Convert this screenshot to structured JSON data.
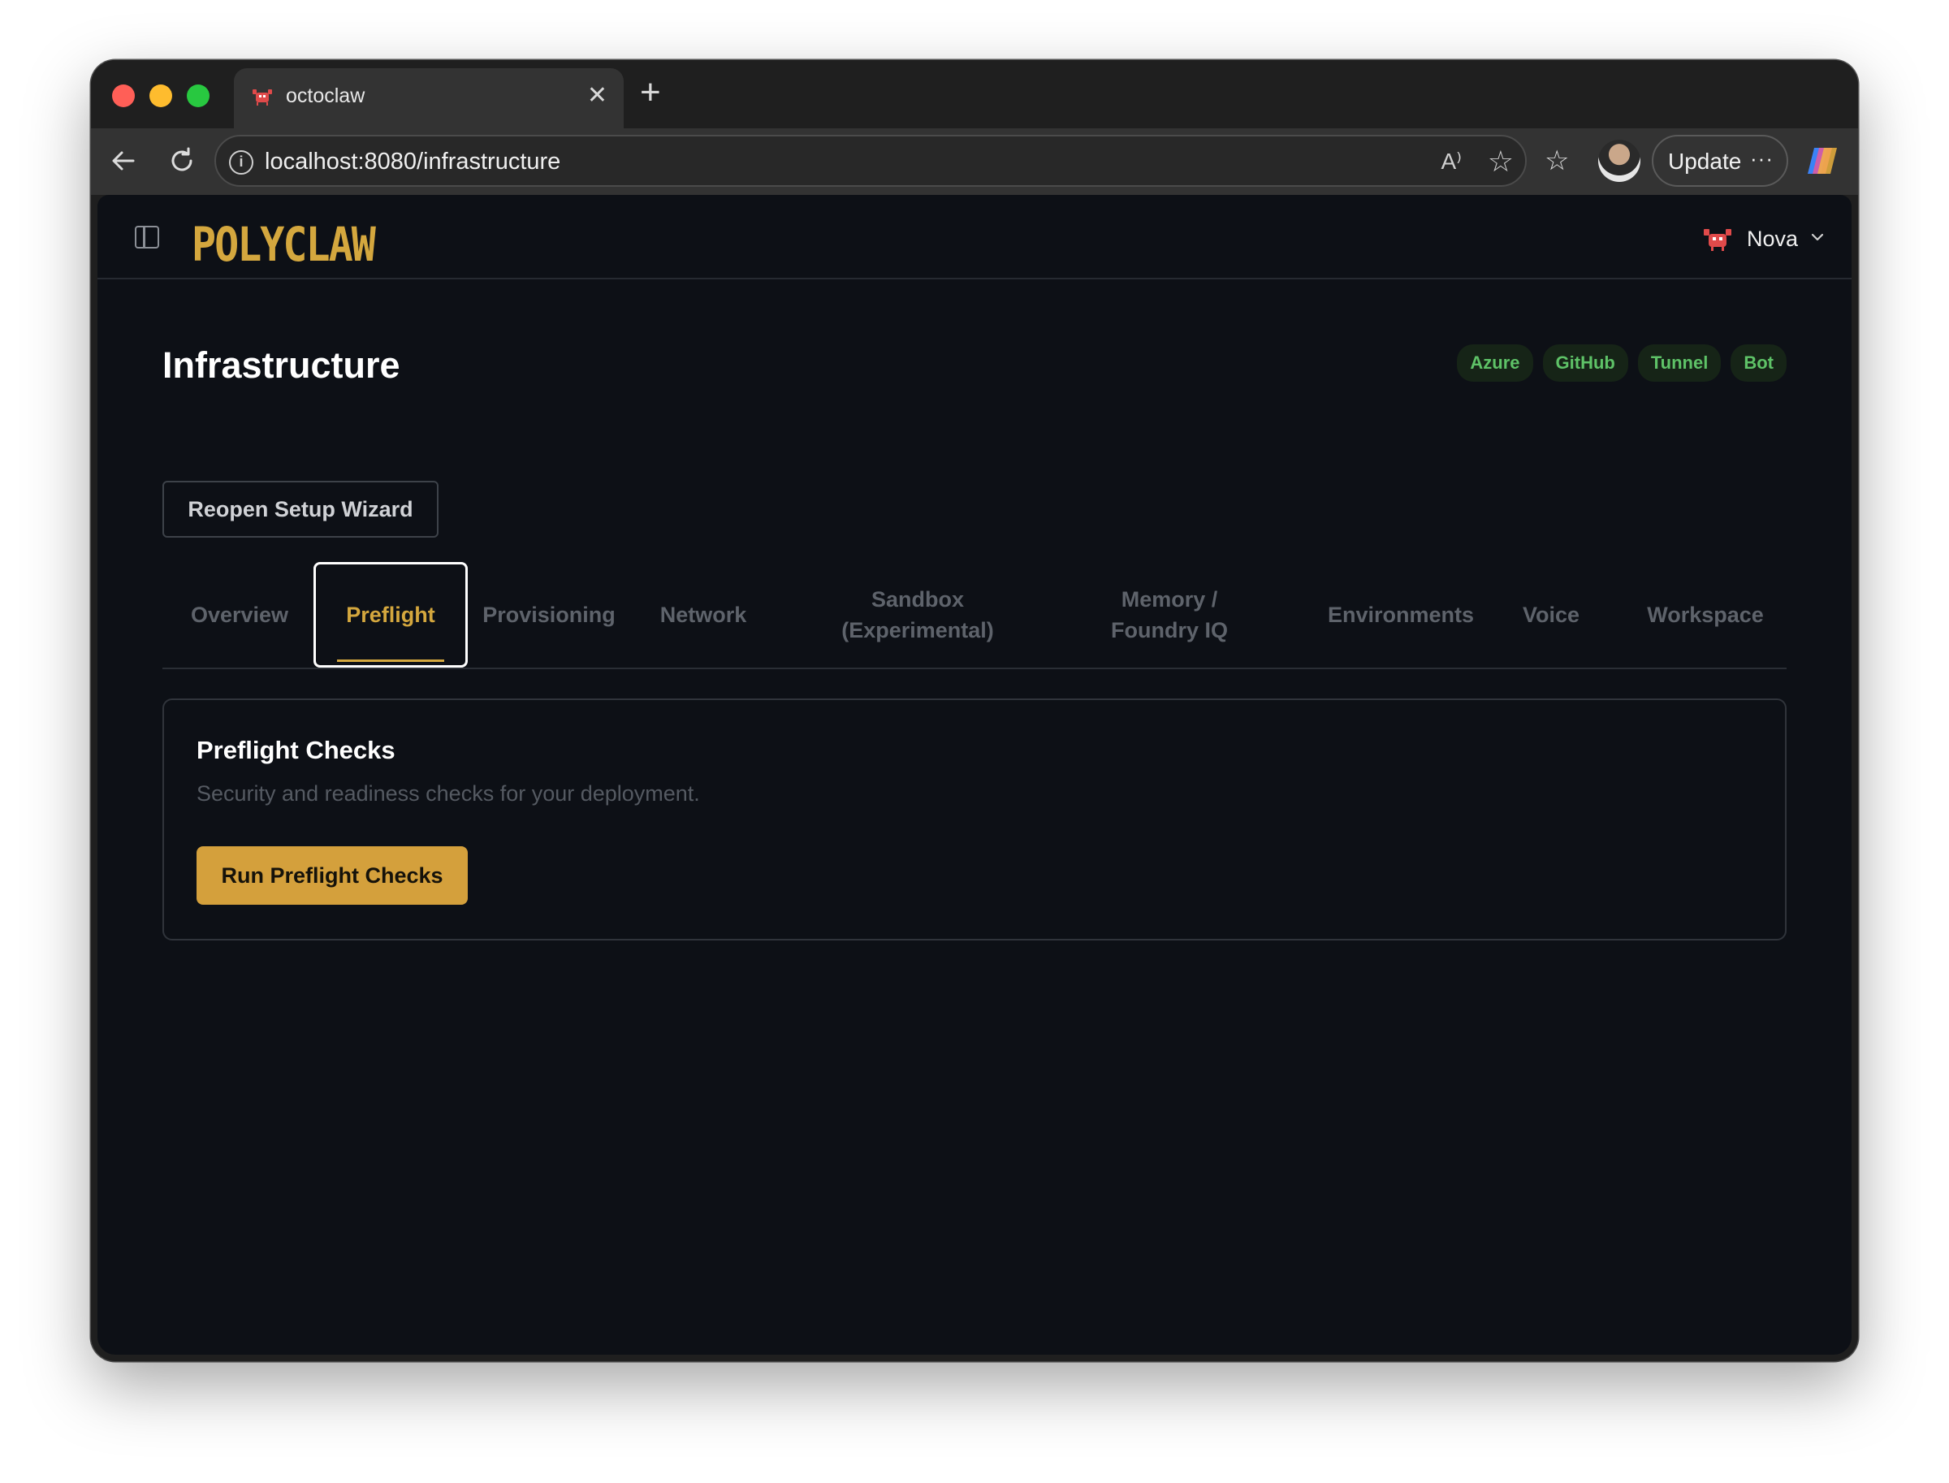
{
  "browser": {
    "tab_title": "octoclaw",
    "url": "localhost:8080/infrastructure",
    "update_label": "Update",
    "update_menu": "···"
  },
  "app": {
    "logo": "POLYCLAW",
    "user": "Nova"
  },
  "page": {
    "title": "Infrastructure",
    "badges": [
      "Azure",
      "GitHub",
      "Tunnel",
      "Bot"
    ],
    "wizard_button": "Reopen Setup Wizard"
  },
  "tabs": [
    {
      "label": "Overview",
      "active": false
    },
    {
      "label": "Preflight",
      "active": true
    },
    {
      "label": "Provisioning",
      "active": false
    },
    {
      "label": "Network",
      "active": false
    },
    {
      "label": "Sandbox (Experimental)",
      "active": false
    },
    {
      "label": "Memory / Foundry IQ",
      "active": false
    },
    {
      "label": "Environments",
      "active": false
    },
    {
      "label": "Voice",
      "active": false
    },
    {
      "label": "Workspace",
      "active": false
    }
  ],
  "card": {
    "title": "Preflight Checks",
    "subtitle": "Security and readiness checks for your deployment.",
    "button": "Run Preflight Checks"
  },
  "colors": {
    "accent": "#d4a03c",
    "badge_text": "#5ec267",
    "background": "#0d1016"
  }
}
